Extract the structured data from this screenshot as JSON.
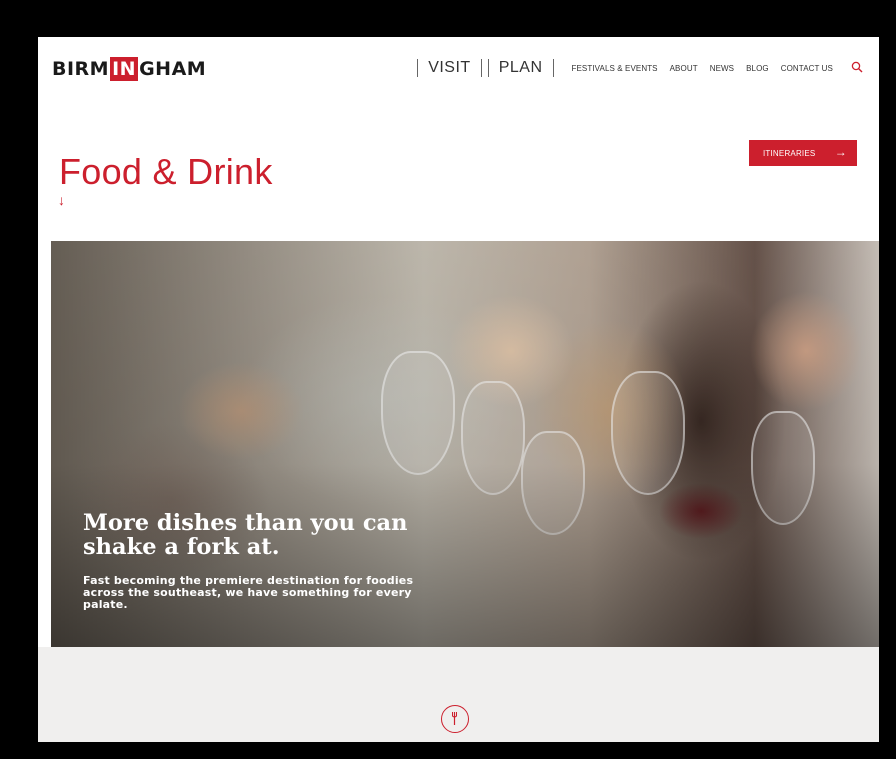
{
  "header": {
    "logo": {
      "pre": "BIRM",
      "box": "IN",
      "post": "GHAM"
    },
    "nav_primary": [
      "VISIT",
      "PLAN"
    ],
    "nav_secondary": [
      "FESTIVALS & EVENTS",
      "ABOUT",
      "NEWS",
      "BLOG",
      "CONTACT US"
    ]
  },
  "page": {
    "title": "Food & Drink",
    "down_arrow": "↓",
    "itineraries_label": "ITINERARIES",
    "itineraries_arrow": "→"
  },
  "hero": {
    "headline": "More dishes than you can shake a fork at.",
    "subtext": "Fast becoming the premiere destination for foodies across the southeast, we have something for every palate."
  },
  "icons": {
    "search": "search-icon",
    "fork": "fork-icon"
  },
  "colors": {
    "accent": "#cc1f2d",
    "band": "#f0efee",
    "frame": "#000000"
  }
}
